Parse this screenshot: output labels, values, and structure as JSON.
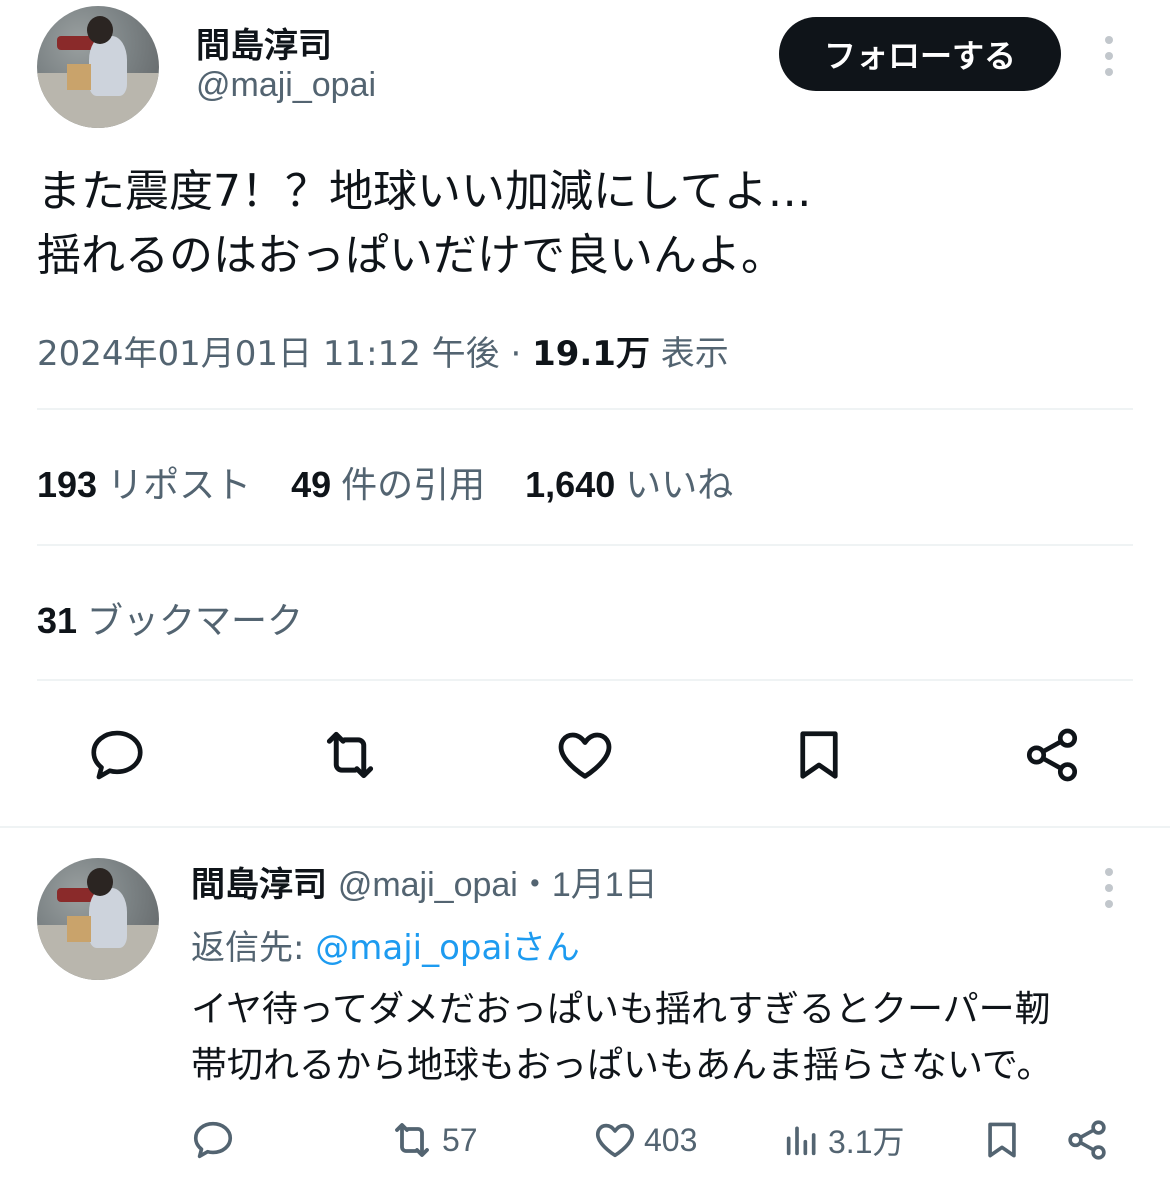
{
  "author": {
    "name": "間島淳司",
    "handle": "@maji_opai"
  },
  "follow_button": "フォローする",
  "tweet": {
    "lines": [
      "また震度7！？地球いい加減にしてよ…",
      "揺れるのはおっぱいだけで良いんよ。"
    ],
    "timestamp": "2024年01月01日 11:12 午後 · ",
    "views_count": "19.1万",
    "views_label": " 表示"
  },
  "stats": {
    "reposts_count": "193",
    "reposts_label": "リポスト",
    "quotes_count": "49",
    "quotes_label": "件の引用",
    "likes_count": "1,640",
    "likes_label": "いいね",
    "bookmarks_count": "31",
    "bookmarks_label": "ブックマーク"
  },
  "icons": {
    "actions": [
      "reply-icon",
      "retweet-icon",
      "like-icon",
      "bookmark-icon",
      "share-icon"
    ],
    "more": "more-vertical-icon"
  },
  "reply": {
    "name": "間島淳司",
    "handle": "@maji_opai",
    "date": "・1月1日",
    "reply_to_prefix": "返信先: ",
    "reply_to_mention": "@maji_opaiさん",
    "lines": [
      "イヤ待ってダメだおっぱいも揺れすぎるとクーパー靭",
      "帯切れるから地球もおっぱいもあんま揺らさないで。"
    ],
    "retweets": "57",
    "likes": "403",
    "views": "3.1万"
  },
  "colors": {
    "text": "#0f1419",
    "secondary": "#536471",
    "link": "#1d9bf0",
    "divider": "#eff3f4",
    "button_bg": "#0f1419"
  }
}
